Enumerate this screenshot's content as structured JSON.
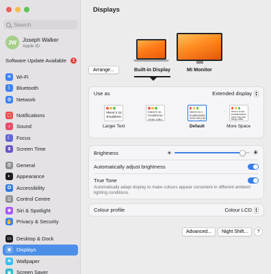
{
  "window": {
    "traffic_colors": [
      "#ec5f55",
      "#f3bd4f",
      "#5fc454"
    ]
  },
  "sidebar": {
    "search_placeholder": "Search",
    "account": {
      "initials": "JW",
      "name": "Joseph Walker",
      "subtitle": "Apple ID"
    },
    "update": {
      "label": "Software Update Available",
      "count": "1"
    },
    "groups": [
      [
        {
          "label": "Wi-Fi",
          "icon": "wifi-icon",
          "color": "#3b82f6",
          "glyph": "≋"
        },
        {
          "label": "Bluetooth",
          "icon": "bluetooth-icon",
          "color": "#3b82f6",
          "glyph": "ᛒ"
        },
        {
          "label": "Network",
          "icon": "network-icon",
          "color": "#3b82f6",
          "glyph": "◍"
        }
      ],
      [
        {
          "label": "Notifications",
          "icon": "notifications-icon",
          "color": "#ec4b4b",
          "glyph": "▢"
        },
        {
          "label": "Sound",
          "icon": "sound-icon",
          "color": "#ec4b6a",
          "glyph": "♪"
        },
        {
          "label": "Focus",
          "icon": "focus-icon",
          "color": "#6366d9",
          "glyph": "☾"
        },
        {
          "label": "Screen Time",
          "icon": "screen-time-icon",
          "color": "#6b54c9",
          "glyph": "⧗"
        }
      ],
      [
        {
          "label": "General",
          "icon": "gear-icon",
          "color": "#8e8e93",
          "glyph": "⚙"
        },
        {
          "label": "Appearance",
          "icon": "appearance-icon",
          "color": "#1d1d1f",
          "glyph": "◐"
        },
        {
          "label": "Accessibility",
          "icon": "accessibility-icon",
          "color": "#2f7ae5",
          "glyph": "✪"
        },
        {
          "label": "Control Centre",
          "icon": "control-centre-icon",
          "color": "#8e8e93",
          "glyph": "☰"
        },
        {
          "label": "Siri & Spotlight",
          "icon": "siri-icon",
          "color": "#a855f7",
          "glyph": "◉"
        },
        {
          "label": "Privacy & Security",
          "icon": "privacy-icon",
          "color": "#3b82f6",
          "glyph": "✋"
        }
      ],
      [
        {
          "label": "Desktop & Dock",
          "icon": "desktop-dock-icon",
          "color": "#1d1d1f",
          "glyph": "▭"
        },
        {
          "label": "Displays",
          "icon": "displays-icon",
          "color": "#3b82f6",
          "glyph": "✺",
          "active": true
        },
        {
          "label": "Wallpaper",
          "icon": "wallpaper-icon",
          "color": "#38bdf8",
          "glyph": "❀"
        },
        {
          "label": "Screen Saver",
          "icon": "screen-saver-icon",
          "color": "#22b8cf",
          "glyph": "▣"
        }
      ]
    ]
  },
  "main": {
    "title": "Displays",
    "arrange_label": "Arrange...",
    "displays": [
      {
        "label": "Built-in Display",
        "selected": true
      },
      {
        "label": "Mi Monitor",
        "selected": false
      }
    ],
    "use_as": {
      "label": "Use as",
      "value": "Extended display"
    },
    "resolution_options": [
      {
        "label": "Larger Text",
        "preview": "Here's to\ntroublem",
        "selected": false
      },
      {
        "label": "",
        "preview": "Here's to\ntroubleme\nones who",
        "selected": false
      },
      {
        "label": "Default",
        "preview": "Here's to t\ntroublemake\nones who se\nthings diffe",
        "selected": true
      },
      {
        "label": "More Space",
        "preview": "Here's to the\ntroublemakers\nones who see\nthings differ\nrules. And\ncan quote",
        "selected": false
      }
    ],
    "brightness": {
      "label": "Brightness",
      "value": 0.9
    },
    "auto_brightness": {
      "label": "Automatically adjust brightness",
      "on": true
    },
    "true_tone": {
      "label": "True Tone",
      "on": true,
      "description": "Automatically adapt display to make colours appear consistent in different ambient lighting conditions."
    },
    "colour_profile": {
      "label": "Colour profile",
      "value": "Colour LCD"
    },
    "buttons": {
      "advanced": "Advanced...",
      "night_shift": "Night Shift...",
      "help": "?"
    }
  },
  "colors": {
    "accent": "#3b7ee6",
    "selection": "#4d8fe8"
  }
}
